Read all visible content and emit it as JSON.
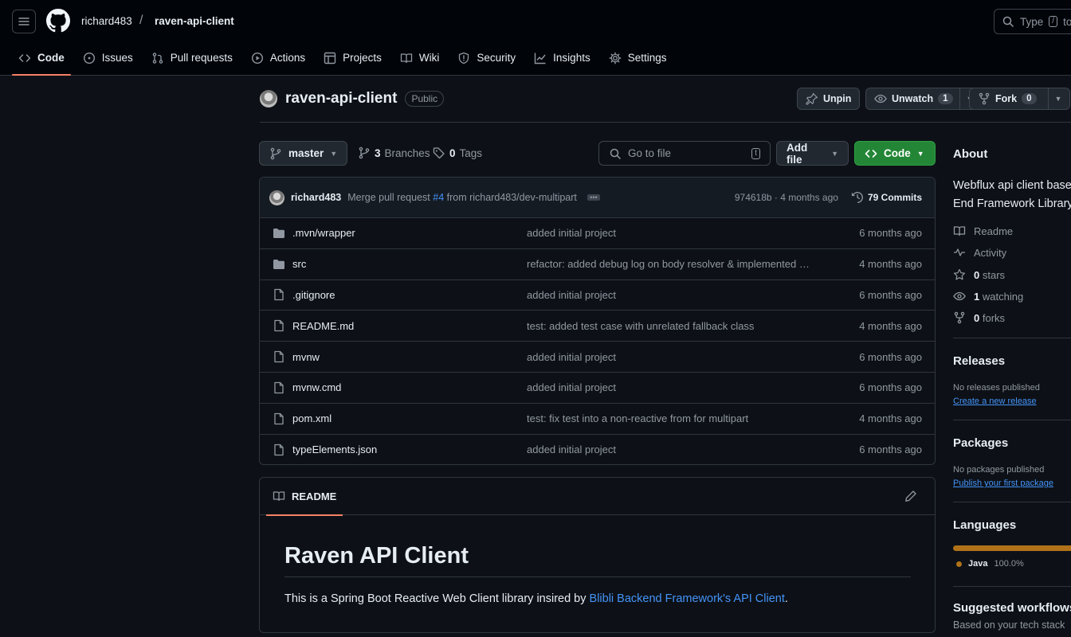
{
  "header": {
    "owner": "richard483",
    "separator": "/",
    "repo": "raven-api-client",
    "search_placeholder": "Type",
    "search_key": "/",
    "search_suffix": "to"
  },
  "tabs": [
    {
      "label": "Code",
      "icon": "code-icon",
      "active": true
    },
    {
      "label": "Issues",
      "icon": "issue-icon"
    },
    {
      "label": "Pull requests",
      "icon": "pull-request-icon"
    },
    {
      "label": "Actions",
      "icon": "play-icon"
    },
    {
      "label": "Projects",
      "icon": "table-icon"
    },
    {
      "label": "Wiki",
      "icon": "book-icon"
    },
    {
      "label": "Security",
      "icon": "shield-icon"
    },
    {
      "label": "Insights",
      "icon": "graph-icon"
    },
    {
      "label": "Settings",
      "icon": "gear-icon"
    }
  ],
  "repo_header": {
    "name": "raven-api-client",
    "visibility": "Public",
    "unpin_label": "Unpin",
    "unwatch_label": "Unwatch",
    "watch_count": "1",
    "fork_label": "Fork",
    "fork_count": "0"
  },
  "toolbar": {
    "branch": "master",
    "branches_count": "3",
    "branches_label": "Branches",
    "tags_count": "0",
    "tags_label": "Tags",
    "go_to_file": "Go to file",
    "go_to_file_key": "t",
    "add_file": "Add file",
    "code": "Code"
  },
  "latest_commit": {
    "author": "richard483",
    "message_prefix": "Merge pull request",
    "pr_link": "#4",
    "message_suffix": "from richard483/dev-multipart",
    "sha_time": "974618b · 4 months ago",
    "commits_count": "79 Commits"
  },
  "files": [
    {
      "name": ".mvn/wrapper",
      "type": "folder",
      "message": "added initial project",
      "date": "6 months ago"
    },
    {
      "name": "src",
      "type": "folder",
      "message": "refactor: added debug log on body resolver & implemented …",
      "date": "4 months ago"
    },
    {
      "name": ".gitignore",
      "type": "file",
      "message": "added initial project",
      "date": "6 months ago"
    },
    {
      "name": "README.md",
      "type": "file",
      "message": "test: added test case with unrelated fallback class",
      "date": "4 months ago"
    },
    {
      "name": "mvnw",
      "type": "file",
      "message": "added initial project",
      "date": "6 months ago"
    },
    {
      "name": "mvnw.cmd",
      "type": "file",
      "message": "added initial project",
      "date": "6 months ago"
    },
    {
      "name": "pom.xml",
      "type": "file",
      "message": "test: fix test into a non-reactive from for multipart",
      "date": "4 months ago"
    },
    {
      "name": "typeElements.json",
      "type": "file",
      "message": "added initial project",
      "date": "6 months ago"
    }
  ],
  "readme": {
    "tab_label": "README",
    "title": "Raven API Client",
    "text_before": "This is a Spring Boot Reactive Web Client library insired by ",
    "link_text": "Blibli Backend Framework's API Client",
    "text_after": "."
  },
  "sidebar": {
    "about_title": "About",
    "about_line1": "Webflux api client base",
    "about_line2": "End Framework Library",
    "readme": "Readme",
    "activity": "Activity",
    "stars_count": "0",
    "stars_label": "stars",
    "watching_count": "1",
    "watching_label": "watching",
    "forks_count": "0",
    "forks_label": "forks",
    "releases_title": "Releases",
    "releases_none": "No releases published",
    "releases_link": "Create a new release",
    "packages_title": "Packages",
    "packages_none": "No packages published",
    "packages_link": "Publish your first package",
    "languages_title": "Languages",
    "language_name": "Java",
    "language_pct": "100.0%",
    "language_share": 1.0,
    "language_color": "#b07219",
    "workflows_title": "Suggested workflows",
    "workflows_sub": "Based on your tech stack"
  },
  "colors": {
    "accent_tab": "#f78166",
    "code_button": "#238636",
    "link": "#4493f8"
  }
}
